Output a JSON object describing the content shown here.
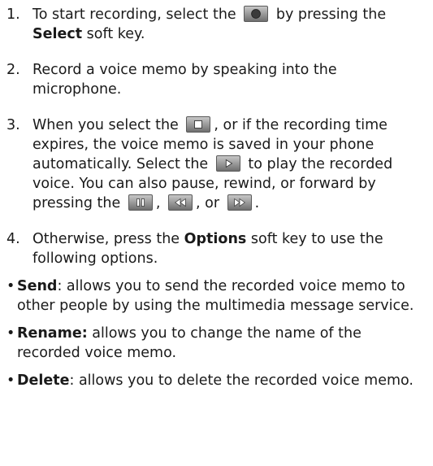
{
  "steps": [
    {
      "num": "1.",
      "a": "To start recording, select the",
      "icon1": "record-icon",
      "b": "by pressing the",
      "bold": "Select",
      "c": "soft key."
    },
    {
      "num": "2.",
      "text": "Record a voice memo by speaking into the microphone."
    },
    {
      "num": "3.",
      "a": "When you select the",
      "icon_stop": "stop-icon",
      "b": ", or if the recording time expires, the voice memo is saved in your phone automatically. Select the",
      "icon_play": "play-icon",
      "c": "to play the recorded voice. You can also pause, rewind, or forward by pressing the",
      "icon_pause": "pause-icon",
      "sep1": ",",
      "icon_rewind": "rewind-icon",
      "sep2": ", or",
      "icon_forward": "forward-icon",
      "end": "."
    },
    {
      "num": "4.",
      "a": "Otherwise, press the",
      "bold": "Options",
      "b": "soft key to use the following options."
    }
  ],
  "options": [
    {
      "bullet": "•",
      "term": "Send",
      "desc": ": allows you to send the recorded voice memo to other people by using the multimedia message service."
    },
    {
      "bullet": "•",
      "term": "Rename:",
      "desc": " allows you to change the name of the recorded voice memo."
    },
    {
      "bullet": "•",
      "term": "Delete",
      "desc": ": allows you to delete the recorded voice memo."
    }
  ]
}
